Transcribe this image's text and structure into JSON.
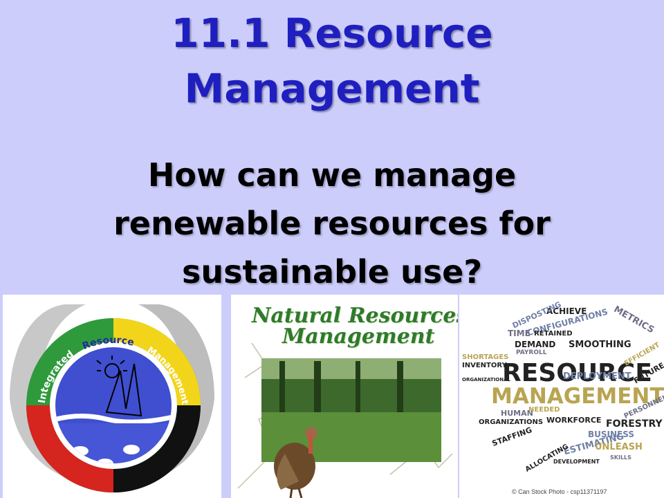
{
  "slide": {
    "title_line1": "11.1 Resource",
    "title_line2": "Management",
    "subtitle_line1": "How can we manage",
    "subtitle_line2": "renewable resources for",
    "subtitle_line3": "sustainable use?"
  },
  "images": {
    "irm_logo": {
      "word1": "Integrated",
      "word2": "Resource",
      "word3": "Management"
    },
    "nrm": {
      "title_line1": "Natural Resources",
      "title_line2": "Management"
    },
    "wordcloud": {
      "words": {
        "resource": "RESOURCE",
        "management": "MANAGEMENT",
        "achieve": "ACHIEVE",
        "metrics": "METRICS",
        "disposting": "DISPOSTING",
        "configurations": "CONFIGURATIONS",
        "time": "TIME",
        "retained": "RETAINED",
        "smoothing": "SMOOTHING",
        "demand": "DEMAND",
        "payroll": "PAYROLL",
        "shortages": "SHORTAGES",
        "inventory": "INVENTORY",
        "organizational": "ORGANIZATIONAL",
        "deployment": "DEPLOYMENT",
        "future": "FUTURE",
        "efficient": "EFFICIENT",
        "human": "HUMAN",
        "needed": "NEEDED",
        "organizations": "ORGANIZATIONS",
        "workforce": "WORKFORCE",
        "forestry": "FORESTRY",
        "personnel": "PERSONNEL",
        "business": "BUSINESS",
        "staffing": "STAFFING",
        "estimating": "ESTIMATING",
        "unleash": "UNLEASH",
        "allocating": "ALLOCATING",
        "development": "DEVELOPMENT",
        "skills": "SKILLS"
      },
      "credit": "© Can Stock Photo - csp11371197"
    }
  },
  "colors": {
    "background": "#cccdfb",
    "title": "#1f1fc0",
    "subtitle": "#000000"
  }
}
